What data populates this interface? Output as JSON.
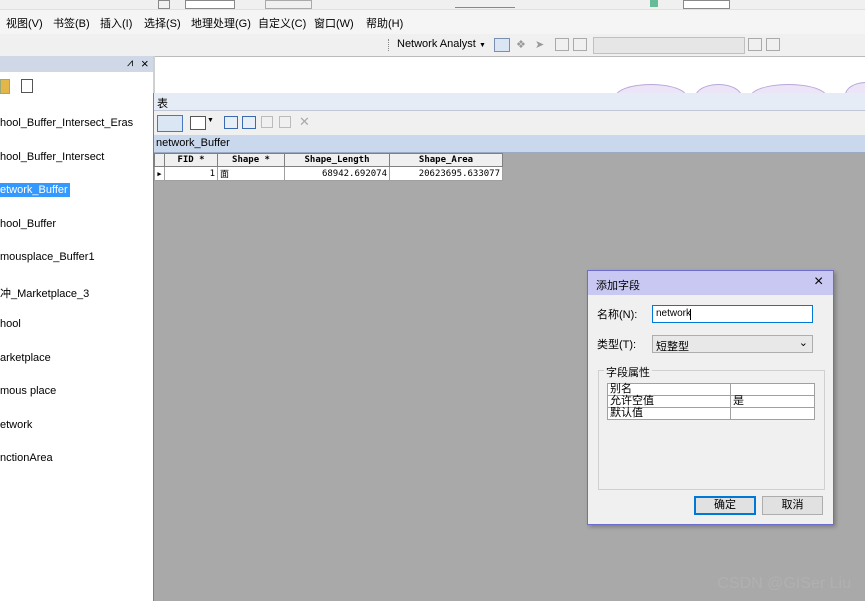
{
  "menu": {
    "items": [
      "视图(V)",
      "书签(B)",
      "插入(I)",
      "选择(S)",
      "地理处理(G)",
      "自定义(C)",
      "窗口(W)",
      "帮助(H)"
    ]
  },
  "toolbar": {
    "network_analyst_label": "Network Analyst"
  },
  "toc": {
    "pin_glyph": "⩘",
    "close_glyph": "×",
    "items": [
      {
        "label": "hool_Buffer_Intersect_Eras",
        "selected": false
      },
      {
        "label": "hool_Buffer_Intersect",
        "selected": false
      },
      {
        "label": "etwork_Buffer",
        "selected": true
      },
      {
        "label": "hool_Buffer",
        "selected": false
      },
      {
        "label": "mousplace_Buffer1",
        "selected": false
      },
      {
        "label": "冲_Marketplace_3",
        "selected": false
      },
      {
        "label": "hool",
        "selected": false
      },
      {
        "label": "arketplace",
        "selected": false
      },
      {
        "label": "mous place",
        "selected": false
      },
      {
        "label": "etwork",
        "selected": false
      },
      {
        "label": "nctionArea",
        "selected": false
      }
    ]
  },
  "table_window": {
    "title": "表",
    "tab_name": "network_Buffer",
    "columns": [
      "FID *",
      "Shape *",
      "Shape_Length",
      "Shape_Area"
    ],
    "rows": [
      {
        "fid": "1",
        "shape": "面",
        "length": "68942.692074",
        "area": "20623695.633077"
      }
    ]
  },
  "dialog": {
    "title": "添加字段",
    "name_label": "名称(N):",
    "name_value": "network",
    "type_label": "类型(T):",
    "type_value": "短整型",
    "props_group_label": "字段属性",
    "properties": [
      {
        "key": "别名",
        "value": ""
      },
      {
        "key": "允许空值",
        "value": "是"
      },
      {
        "key": "默认值",
        "value": ""
      }
    ],
    "ok_label": "确定",
    "cancel_label": "取消",
    "close_glyph": "×"
  },
  "watermark": "CSDN @GISer Liu",
  "colors": {
    "selection": "#3399ff",
    "dialog_title": "#c8c8f2",
    "ok_border": "#0078d7"
  }
}
